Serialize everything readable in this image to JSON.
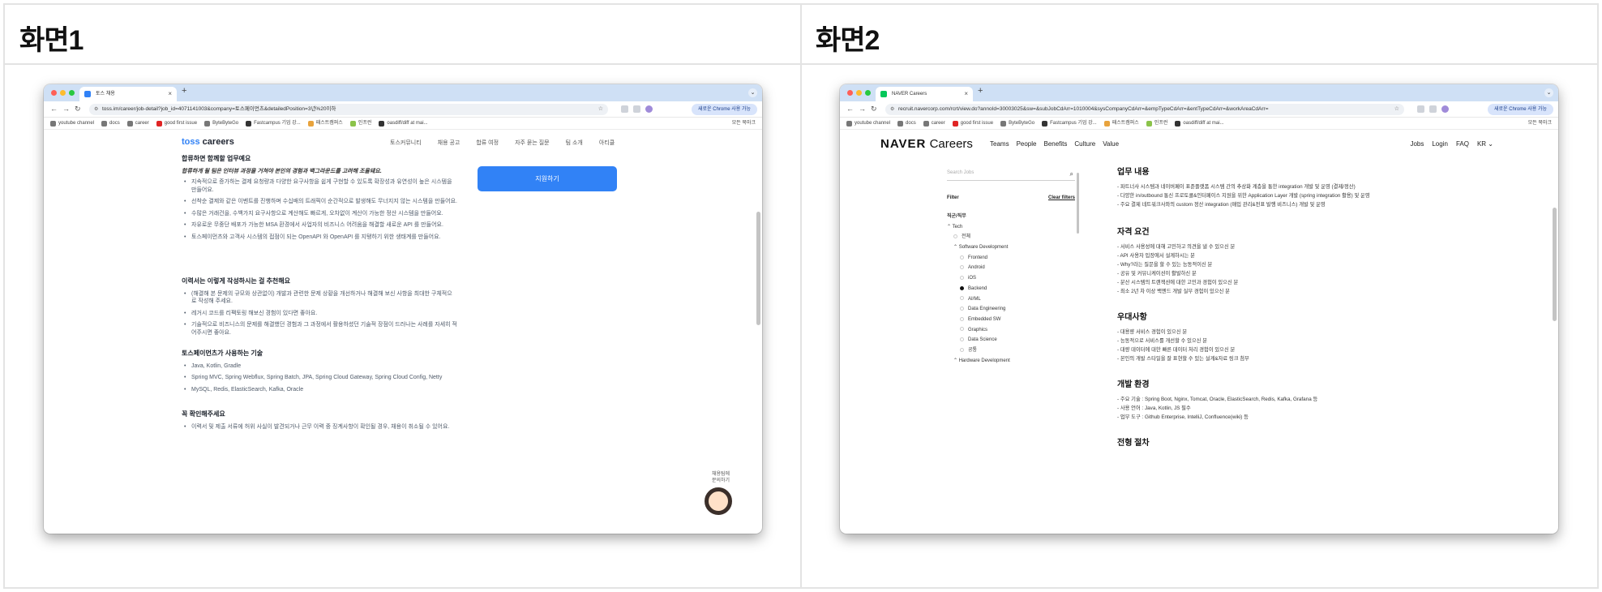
{
  "cells": [
    {
      "title": "화면1",
      "tab_title": "토스 채용",
      "url": "toss.im/career/job-detail?job_id=4071141003&company=토스페이먼츠&detailedPosition=3년%20이하",
      "chrome_button": "새로운 Chrome 사용 가능",
      "bookmarks": [
        "youtube channel",
        "docs",
        "career",
        "good first issue",
        "ByteByteGo",
        "Fastcampus 기업 강...",
        "패스트캠퍼스",
        "인프런",
        "oasdiff/diff at mai..."
      ],
      "bookmarks_right": "모든 북마크"
    },
    {
      "title": "화면2",
      "tab_title": "NAVER Careers",
      "url": "recruit.navercorp.com/rcrt/view.do?annoId=30003025&sw=&subJobCdArr=1010004&sysCompanyCdArr=&empTypeCdArr=&entTypeCdArr=&workAreaCdArr=",
      "chrome_button": "새로운 Chrome 사용 가능",
      "bookmarks": [
        "youtube channel",
        "docs",
        "career",
        "good first issue",
        "ByteByteGo",
        "Fastcampus 기업 강...",
        "패스트캠퍼스",
        "인프런",
        "oasdiff/diff at mai..."
      ],
      "bookmarks_right": "모든 북마크"
    }
  ],
  "toss": {
    "logo_mark": "toss",
    "logo_text": " careers",
    "menu": [
      "토스커뮤니티",
      "채용 공고",
      "합류 여정",
      "자주 묻는 질문",
      "팀 소개",
      "아티클"
    ],
    "apply": "지원하기",
    "helper": [
      "채용팀에",
      "문의하기"
    ],
    "sections": [
      {
        "heading": "합류하면 함께할 업무예요",
        "lead": "합류하게 될 팀은 인터뷰 과정을 거쳐야 본인의 경험과 백그라운드를 고려해 조율돼요.",
        "items": [
          "지속적으로 증가하는 결제 요청량과 다양한 요구사항을 쉽게 구현할 수 있도록 확장성과 유연성이 높은 시스템을 만들어요.",
          "선착순 결제와 같은 이벤트를 진행하며 수십배의 트래픽이 순간적으로 발생해도 무너지지 않는 시스템을 만들어요.",
          "수많은 거래건을, 수백가지 요구사항으로 계산해도 빠르게, 오차없이 계산이 가능한 정산 시스템을 만들어요.",
          "자유로운 무중단 배포가 가능한 MSA 환경에서 사업자의 비즈니스 어려움을 해결할 새로운 API 를 만들어요.",
          "토스페이먼츠와 고객사 시스템의 접점이 되는 OpenAPI 와 OpenAPI 를 지탱하기 위한 생태계를 만들어요."
        ]
      },
      {
        "heading": "이력서는 이렇게 작성하시는 걸 추천해요",
        "lead": "",
        "items": [
          "(해결해 본 문제의 규모와 상관없이) 개발과 관련한 문제 상황을 개선하거나 해결해 보신 사항을 최대한 구체적으로 작성해 주세요.",
          "레거시 코드를 리팩토링 해보신 경험이 있다면 좋아요.",
          "기술적으로 비즈니스의 문제를 해결했던 경험과 그 과정에서 활용하셨던 기술적 장점이 드러나는 사례를 자세히 적어주시면 좋아요."
        ]
      },
      {
        "heading": "토스페이먼츠가 사용하는 기술",
        "lead": "",
        "items": [
          "Java, Kotlin, Gradle",
          "Spring MVC, Spring Webflux, Spring Batch, JPA, Spring Cloud Gateway, Spring Cloud Config, Netty",
          "MySQL, Redis, ElasticSearch, Kafka, Oracle"
        ]
      },
      {
        "heading": "꼭 확인해주세요",
        "lead": "",
        "items": [
          "이력서 및 제출 서류에 허위 사실이 발견되거나 근무 이력 중 징계사항이 확인될 경우, 채용이 취소될 수 있어요."
        ]
      }
    ]
  },
  "naver": {
    "logo_bold": "NAVER",
    "logo_rest": " Careers",
    "menu": [
      "Teams",
      "People",
      "Benefits",
      "Culture",
      "Value"
    ],
    "right_menu": [
      "Jobs",
      "Login",
      "FAQ",
      "KR ⌄"
    ],
    "search_placeholder": "Search Jobs",
    "filter_label": "Filter",
    "clear_filters": "Clear filters",
    "filters": [
      {
        "label": "직군/직무",
        "level": 0,
        "type": "head"
      },
      {
        "label": "Tech",
        "level": 0,
        "type": "expand"
      },
      {
        "label": "전체",
        "level": 1,
        "type": "radio"
      },
      {
        "label": "Software Development",
        "level": 1,
        "type": "expand"
      },
      {
        "label": "Frontend",
        "level": 2,
        "type": "radio"
      },
      {
        "label": "Android",
        "level": 2,
        "type": "radio"
      },
      {
        "label": "iOS",
        "level": 2,
        "type": "radio"
      },
      {
        "label": "Backend",
        "level": 2,
        "type": "radio-on"
      },
      {
        "label": "AI/ML",
        "level": 2,
        "type": "radio"
      },
      {
        "label": "Data Engineering",
        "level": 2,
        "type": "radio"
      },
      {
        "label": "Embedded SW",
        "level": 2,
        "type": "radio"
      },
      {
        "label": "Graphics",
        "level": 2,
        "type": "radio"
      },
      {
        "label": "Data Science",
        "level": 2,
        "type": "radio"
      },
      {
        "label": "공통",
        "level": 2,
        "type": "radio"
      },
      {
        "label": "Hardware Development",
        "level": 1,
        "type": "expand"
      }
    ],
    "sections": [
      {
        "heading": "업무 내용",
        "items": [
          "- 파트너사 시스템과 네이버페이 표준플랫폼 시스템 간의 추상화 계층을 통한 integration 개발 및 운영 (결제/정산)",
          "- 다양한 in/outbound 통신 프로토콜&인터페이스 지원을 위한 Application Layer 개발 (spring integration 활용) 및 운영",
          "- 주요 결제 네트워크사와의 custom 정산 integration (매입 관리&전표 발행 비즈니스) 개발 및 운영"
        ]
      },
      {
        "heading": "자격 요건",
        "items": [
          "- 서비스 사용성에 대해 고민하고 의견을 낼 수 있으신 분",
          "- API 사용자 입장에서 설계하시는 분",
          "- Why?라는 질문을 할 수 있는 능동적이신 분",
          "- 공유 및 커뮤니케이션이 활발하신 분",
          "- 분산 시스템의 트랜잭션에 대한 고민과 경험이 있으신 분",
          "- 최소 2년 차 이상 백엔드 개발 실무 경험이 있으신 분"
        ]
      },
      {
        "heading": "우대사항",
        "items": [
          "- 대용량 서비스 경험이 있으신 분",
          "- 능동적으로 서비스를 개선할 수 있으신 분",
          "- 대량 데이터에 대한 빠른 데이터 처리 경험이 있으신 분",
          "- 본인의 개발 스타일을 잘 표현할 수 있는 설계&자료 링크 첨부"
        ]
      },
      {
        "heading": "개발 환경",
        "items": [
          "- 주요 기술 : Spring Boot, Nginx, Tomcat, Oracle, ElasticSearch, Redis, Kafka, Grafana 등",
          "- 사용 언어 : Java, Kotlin, JS 필수",
          "- 업무 도구 : Github Enterprise, IntelliJ, Confluence(wiki) 등"
        ]
      },
      {
        "heading": "전형 절차",
        "items": []
      }
    ]
  }
}
